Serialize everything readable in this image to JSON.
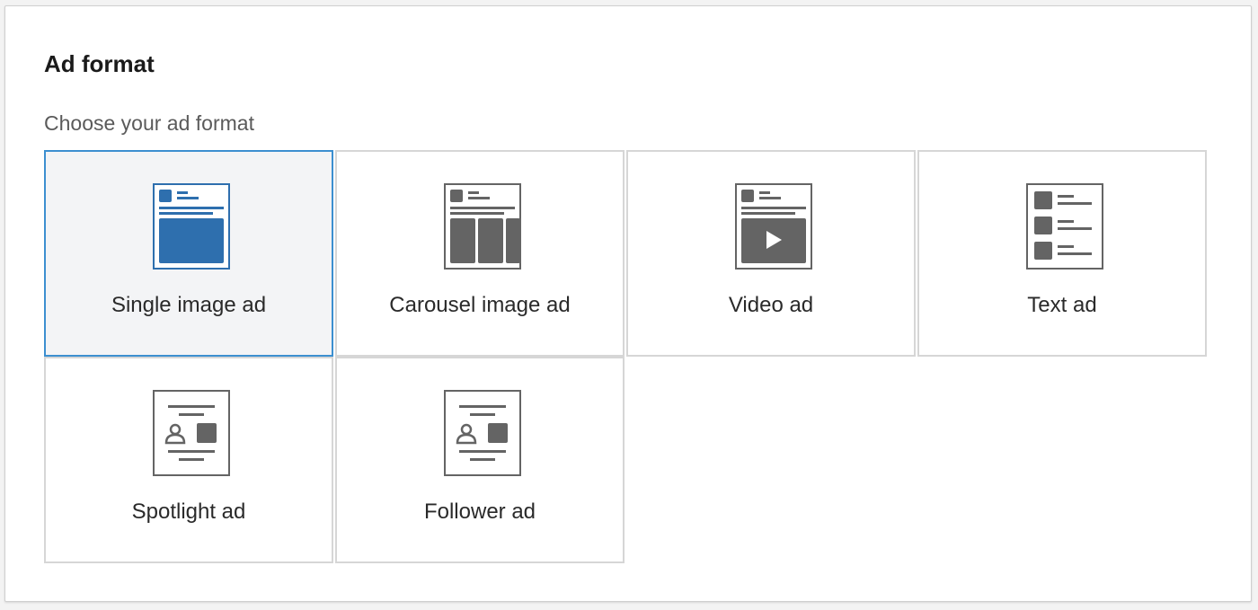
{
  "section": {
    "title": "Ad format",
    "subtitle": "Choose your ad format"
  },
  "formats": [
    {
      "label": "Single image ad",
      "icon": "single-image-ad-icon",
      "selected": true
    },
    {
      "label": "Carousel image ad",
      "icon": "carousel-image-ad-icon",
      "selected": false
    },
    {
      "label": "Video ad",
      "icon": "video-ad-icon",
      "selected": false
    },
    {
      "label": "Text ad",
      "icon": "text-ad-icon",
      "selected": false
    },
    {
      "label": "Spotlight ad",
      "icon": "spotlight-ad-icon",
      "selected": false
    },
    {
      "label": "Follower ad",
      "icon": "follower-ad-icon",
      "selected": false
    }
  ],
  "colors": {
    "selected_accent": "#3c8fd0",
    "selected_icon": "#2e6fae",
    "icon_gray": "#646464"
  }
}
